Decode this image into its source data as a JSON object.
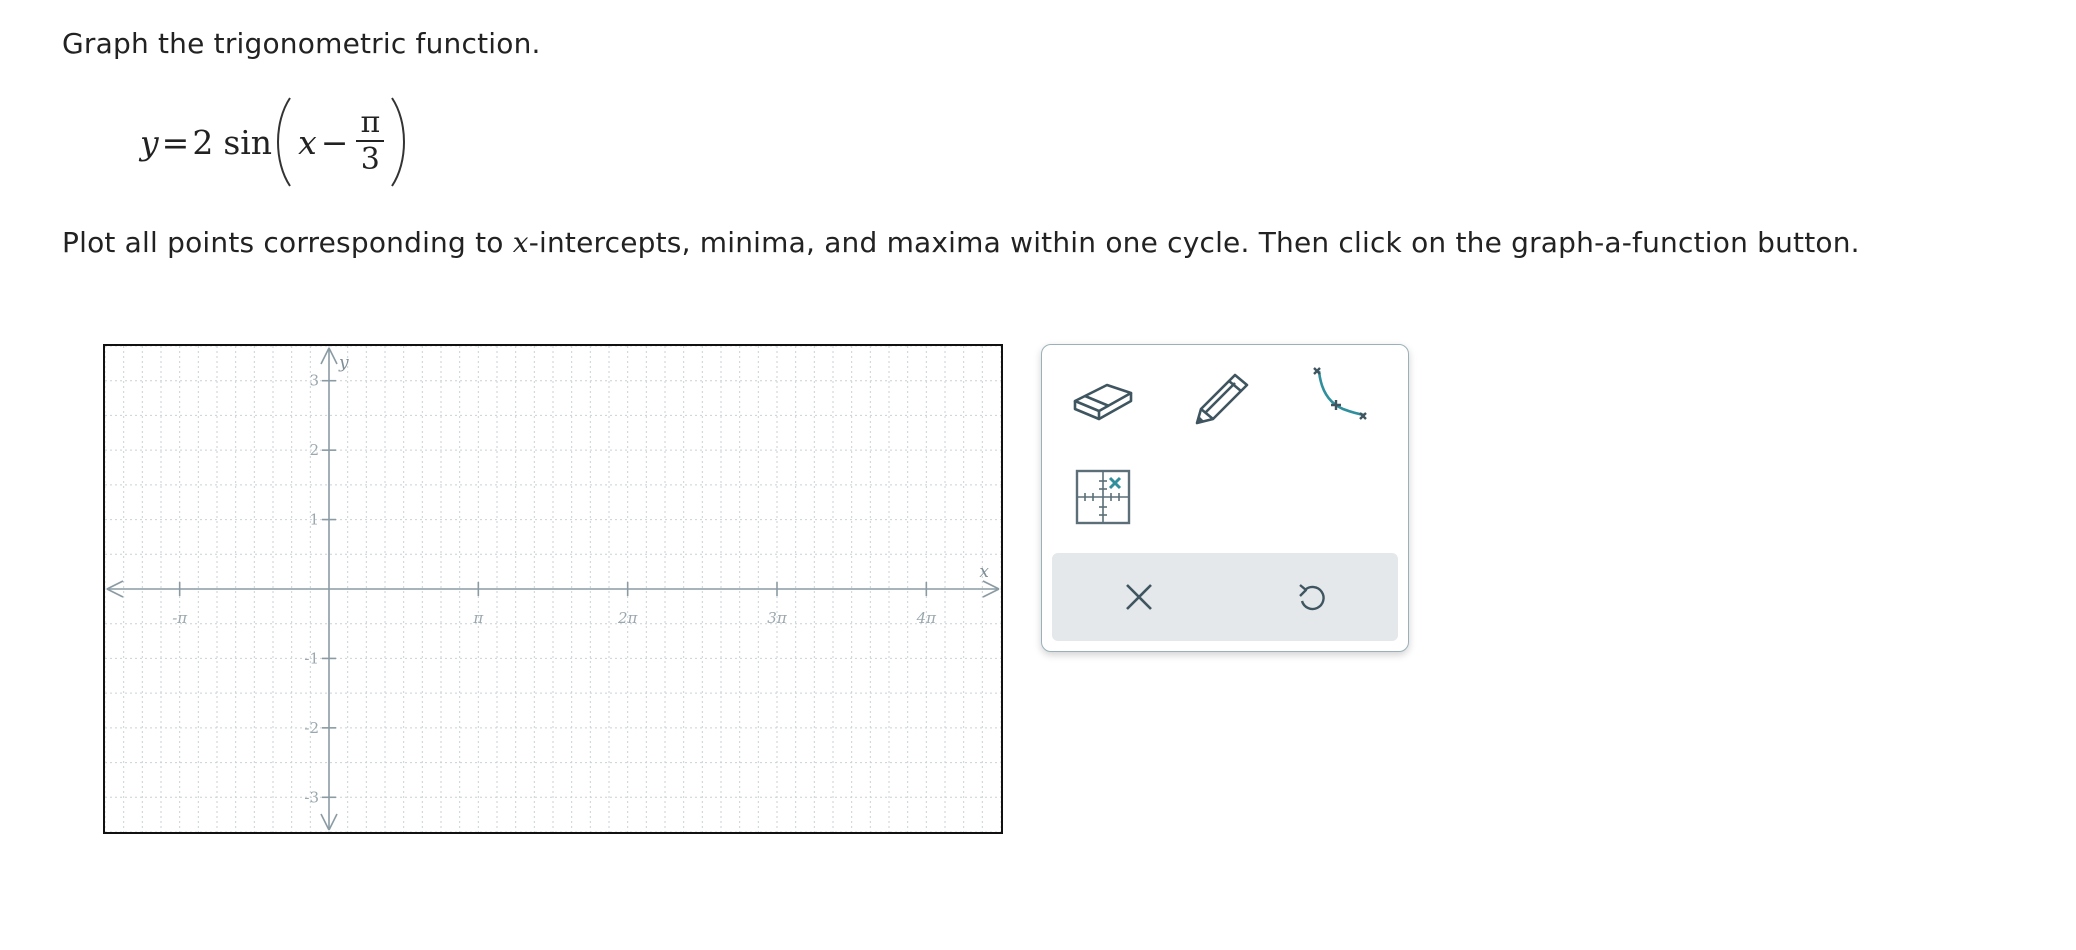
{
  "instructions": {
    "line1": "Graph the trigonometric function.",
    "line2_before": "Plot all points corresponding to ",
    "line2_var": "x",
    "line2_after": "-intercepts, minima, and maxima within one cycle. Then click on the graph-a-function button."
  },
  "equation": {
    "lhs": "y",
    "equals": "=",
    "coefficient": "2",
    "func": "sin",
    "arg_var": "x",
    "minus": "−",
    "numerator": "π",
    "denominator": "3"
  },
  "graph": {
    "x_axis_label": "x",
    "y_axis_label": "y",
    "x_tick_labels": [
      "-π",
      "π",
      "2π",
      "3π",
      "4π"
    ],
    "y_tick_labels": [
      "3",
      "2",
      "1",
      "-1",
      "-2",
      "-3"
    ],
    "x_range_pi": [
      -1.5,
      4.5
    ],
    "y_range": [
      -3.5,
      3.5
    ],
    "grid_subdivisions_per_pi": 8,
    "axis_color": "#8a9ba4",
    "grid_color": "#c9d2d6"
  },
  "toolbar": {
    "tools": [
      "eraser-icon",
      "pencil-icon",
      "sine-curve-tool-icon",
      "point-plot-icon"
    ],
    "actions": [
      "clear-icon",
      "undo-icon"
    ],
    "accent_color": "#2f8f9d",
    "icon_color": "#3f5560"
  }
}
